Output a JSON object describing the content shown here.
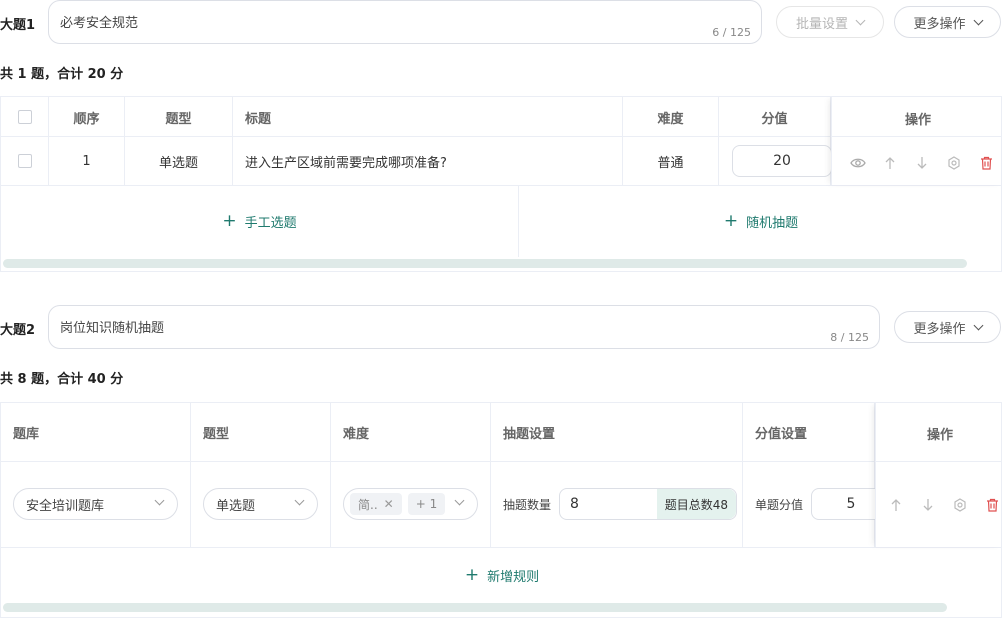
{
  "colors": {
    "accent": "#1f7a6e",
    "danger": "#e05050",
    "border": "#ebeef5"
  },
  "section1": {
    "label": "大题1",
    "title_value": "必考安全规范",
    "title_counter": "6 / 125",
    "batch_button": "批量设置",
    "more_button": "更多操作",
    "summary": "共 1 题，合计 20 分",
    "table": {
      "headers": {
        "order": "顺序",
        "type": "题型",
        "title": "标题",
        "difficulty": "难度",
        "score": "分值",
        "actions": "操作"
      },
      "rows": [
        {
          "order": "1",
          "type": "单选题",
          "title": "进入生产区域前需要完成哪项准备?",
          "difficulty": "普通",
          "score": "20"
        }
      ],
      "action_icons": [
        "eye-icon",
        "arrow-up-icon",
        "arrow-down-icon",
        "gear-icon",
        "trash-icon"
      ]
    },
    "add_manual": "手工选题",
    "add_random": "随机抽题"
  },
  "section2": {
    "label": "大题2",
    "title_value": "岗位知识随机抽题",
    "title_counter": "8 / 125",
    "more_button": "更多操作",
    "summary": "共 8 题，合计 40 分",
    "table": {
      "headers": {
        "bank": "题库",
        "type": "题型",
        "difficulty": "难度",
        "draw": "抽题设置",
        "score": "分值设置",
        "actions": "操作"
      },
      "rows": [
        {
          "bank": "安全培训题库",
          "type": "单选题",
          "difficulty_tag": "简..",
          "difficulty_more": "+ 1",
          "draw_label": "抽题数量",
          "draw_value": "8",
          "draw_total": "题目总数48",
          "score_label": "单题分值",
          "score_value": "5"
        }
      ],
      "action_icons": [
        "arrow-up-icon",
        "arrow-down-icon",
        "gear-icon",
        "trash-icon"
      ]
    },
    "add_rule": "新增规则"
  }
}
